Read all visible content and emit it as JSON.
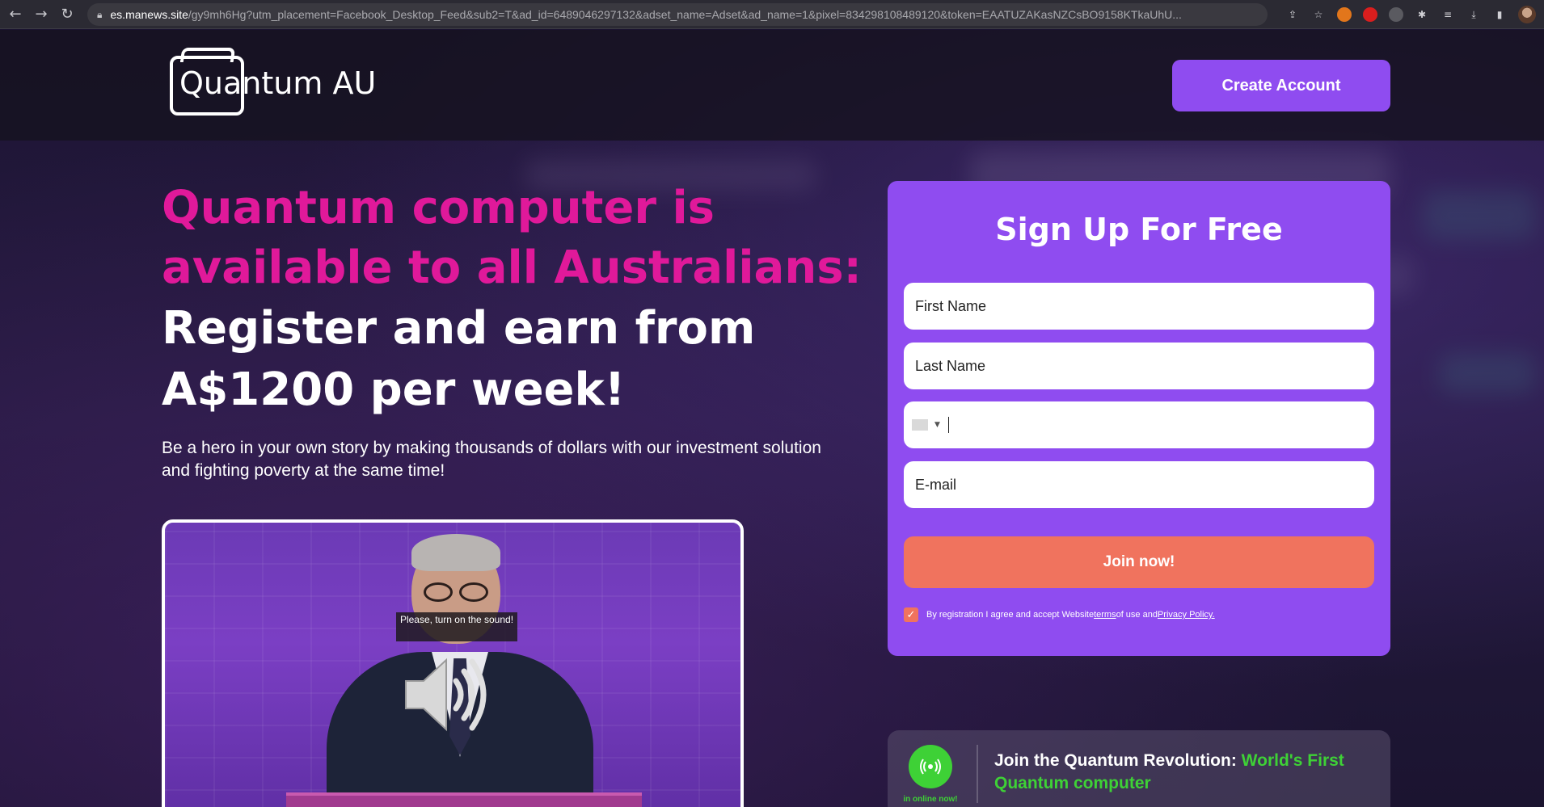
{
  "browser": {
    "url_host": "es.manews.site",
    "url_path": "/gy9mh6Hg?utm_placement=Facebook_Desktop_Feed&sub2=T&ad_id=6489046297132&adset_name=Adset&ad_name=1&pixel=834298108489120&token=EAATUZAKasNZCsBO9158KTkaUhU..."
  },
  "header": {
    "logo_text": "Quantum AU",
    "create_account_label": "Create Account"
  },
  "hero": {
    "headline_pink": "Quantum computer is available to all Australians:",
    "headline_white": "Register and earn from A$1200 per week!",
    "subtitle": "Be a hero in your own story by making thousands of dollars with our investment solution and fighting poverty at the same time!"
  },
  "video": {
    "caption": "Please, turn on the sound!"
  },
  "signup": {
    "title": "Sign Up For Free",
    "first_name_placeholder": "First Name",
    "last_name_placeholder": "Last Name",
    "email_placeholder": "E-mail",
    "join_label": "Join now!",
    "agree_prefix": "By registration I agree and accept Website ",
    "agree_terms": "terms",
    "agree_middle": " of use and ",
    "agree_privacy": "Privacy Policy."
  },
  "revolution": {
    "live_label": "in online now!",
    "text_white": "Join the Quantum Revolution: ",
    "text_green": "World's First Quantum computer"
  },
  "colors": {
    "accent_purple": "#8f4cf0",
    "headline_pink": "#e0199a",
    "join_orange": "#f0735e",
    "live_green": "#3ed136"
  }
}
